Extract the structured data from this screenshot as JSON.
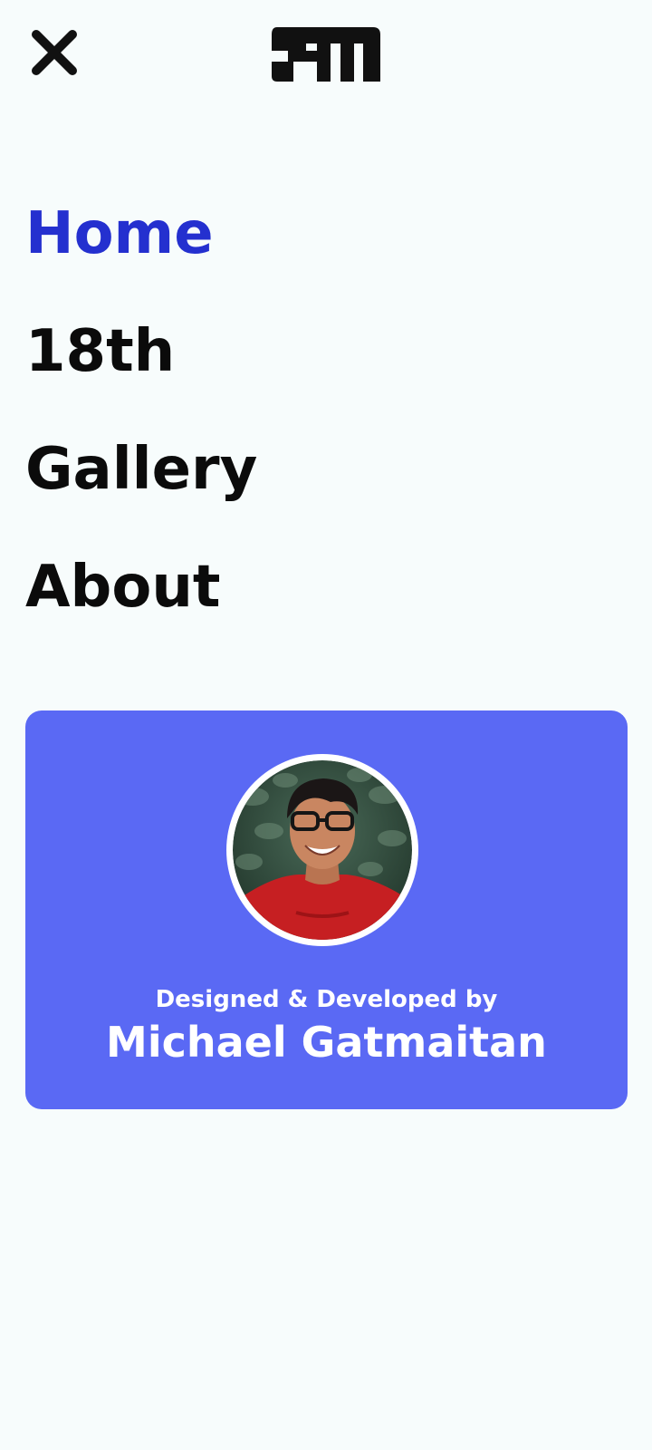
{
  "header": {
    "close_icon": "close-icon",
    "logo_icon": "gm-logo"
  },
  "nav": {
    "items": [
      {
        "label": "Home",
        "active": true
      },
      {
        "label": "18th",
        "active": false
      },
      {
        "label": "Gallery",
        "active": false
      },
      {
        "label": "About",
        "active": false
      }
    ]
  },
  "credit": {
    "caption": "Designed & Developed by",
    "name": "Michael Gatmaitan"
  },
  "colors": {
    "background": "#f7fcfc",
    "active_link": "#2430cf",
    "card": "#5a69f4",
    "text": "#0b0b0b"
  }
}
